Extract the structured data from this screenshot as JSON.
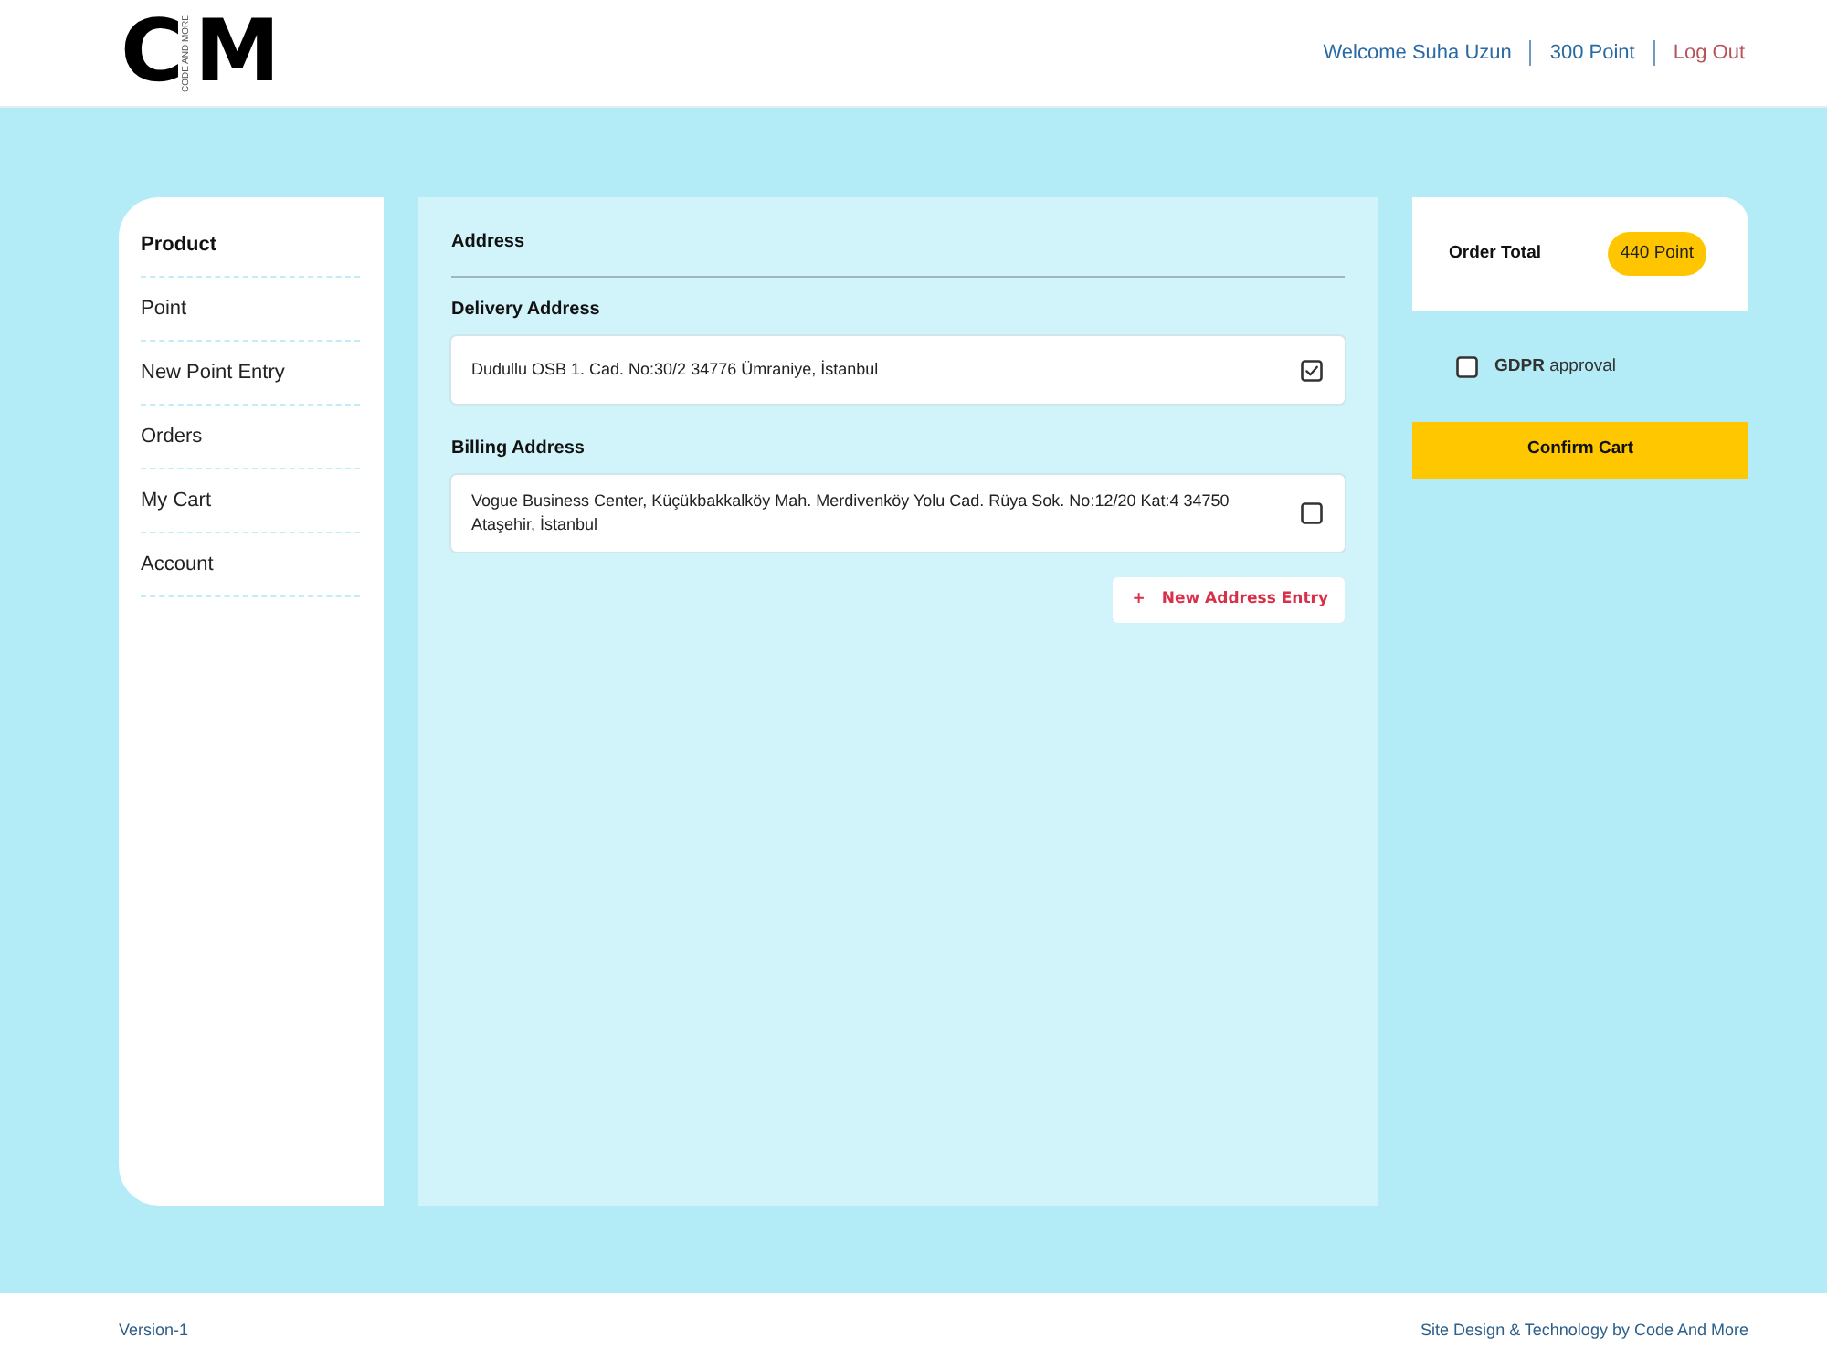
{
  "header": {
    "logo": {
      "left_letter": "C",
      "tagline": "CODE AND MORE",
      "right_letter": "M"
    },
    "nav": [
      {
        "kind": "welcome",
        "label": "Welcome Suha Uzun"
      },
      {
        "kind": "points",
        "label": "300 Point"
      },
      {
        "kind": "logout",
        "label": "Log Out"
      }
    ]
  },
  "sidebar": {
    "items": [
      {
        "label": "Product",
        "selected": true
      },
      {
        "label": "Point",
        "selected": false
      },
      {
        "label": "New Point Entry",
        "selected": false
      },
      {
        "label": "Orders",
        "selected": false
      },
      {
        "label": "My Cart",
        "selected": false
      },
      {
        "label": "Account",
        "selected": false
      }
    ]
  },
  "address_panel": {
    "title": "Address",
    "groups": [
      {
        "heading": "Delivery Address",
        "address": "Dudullu OSB 1. Cad. No:30/2 34776 Ümraniye, İstanbul",
        "checked": true
      },
      {
        "heading": "Billing Address",
        "address": "Vogue Business Center, Küçükbakkalköy Mah. Merdivenköy Yolu Cad. Rüya Sok. No:12/20 Kat:4 34750 Ataşehir, İstanbul",
        "checked": false
      }
    ],
    "new_address_button": {
      "icon": "+",
      "label": "New Address Entry"
    }
  },
  "summary": {
    "order_total_label": "Order Total",
    "order_total_value": "440 Point",
    "gdpr": {
      "text": "**GDPR** approval",
      "checked": false
    },
    "confirm_button": "Confirm Cart"
  },
  "footer": {
    "version": "Version-1",
    "credit": "Site Design & Technology by Code And More"
  }
}
